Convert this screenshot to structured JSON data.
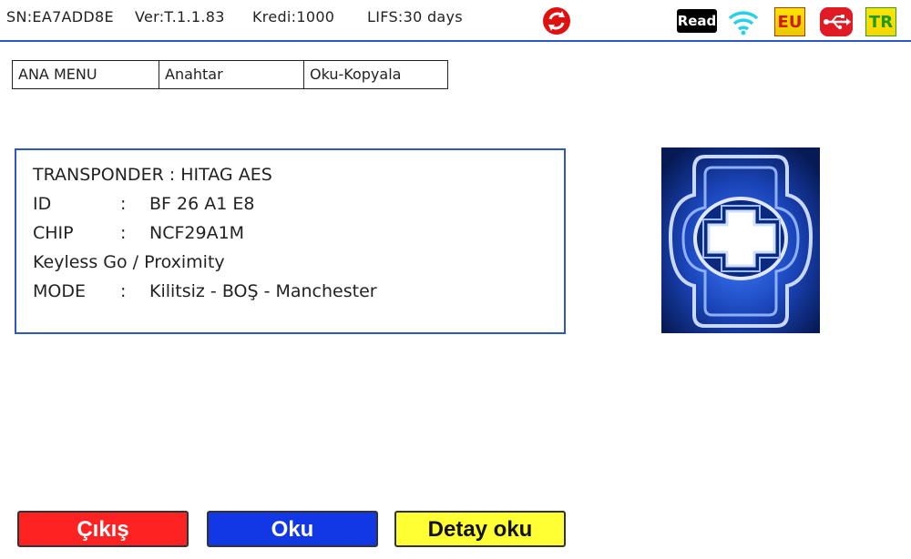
{
  "status_bar": {
    "serial": "SN:EA7ADD8E",
    "version": "Ver:T.1.1.83",
    "credit": "Kredi:1000",
    "lifs": "LIFS:30 days",
    "sync_icon": "refresh-icon",
    "read_badge": "Read",
    "wifi_icon": "wifi-icon",
    "region_badge": "EU",
    "usb_icon": "usb-icon",
    "language_badge": "TR",
    "colors": {
      "accent": "#2b57c9",
      "sync": "#e01010",
      "wifi": "#2ad0e8",
      "usb": "#e11b25"
    }
  },
  "breadcrumb": {
    "items": [
      "ANA MENU",
      "Anahtar",
      "Oku-Kopyala"
    ]
  },
  "transponder": {
    "title": "TRANSPONDER : HITAG AES",
    "id_key": "ID",
    "id_sep": ":",
    "id_value": "BF 26 A1 E8",
    "chip_key": "CHIP",
    "chip_sep": ":",
    "chip_value": "NCF29A1M",
    "feature": "Keyless Go / Proximity",
    "mode_key": "MODE",
    "mode_sep": ":",
    "mode_value": "Kilitsiz - BOŞ - Manchester"
  },
  "key_image": {
    "icon": "key-slot-image"
  },
  "buttons": {
    "exit": "Çıkış",
    "read": "Oku",
    "detail": "Detay oku",
    "colors": {
      "exit": "#ff2222",
      "read": "#1238e6",
      "detail": "#ffff33"
    }
  }
}
